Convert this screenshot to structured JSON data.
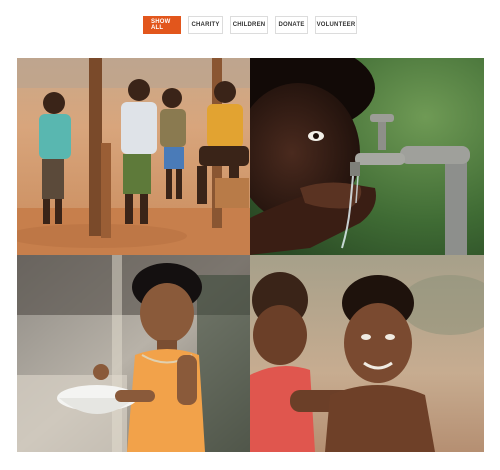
{
  "filters": [
    {
      "label": "SHOW ALL",
      "active": true
    },
    {
      "label": "CHARITY",
      "active": false
    },
    {
      "label": "CHILDREN",
      "active": false
    },
    {
      "label": "DONATE",
      "active": false
    },
    {
      "label": "VOLUNTEER",
      "active": false
    }
  ],
  "colors": {
    "accent": "#e2561c",
    "button_border": "#dcdcdc",
    "button_text": "#333333"
  },
  "gallery": {
    "images": [
      {
        "subject": "four-children-standing-photo"
      },
      {
        "subject": "child-drinking-from-tap-photo"
      },
      {
        "subject": "girl-holding-bowl-photo"
      },
      {
        "subject": "two-children-hugging-photo"
      }
    ]
  }
}
